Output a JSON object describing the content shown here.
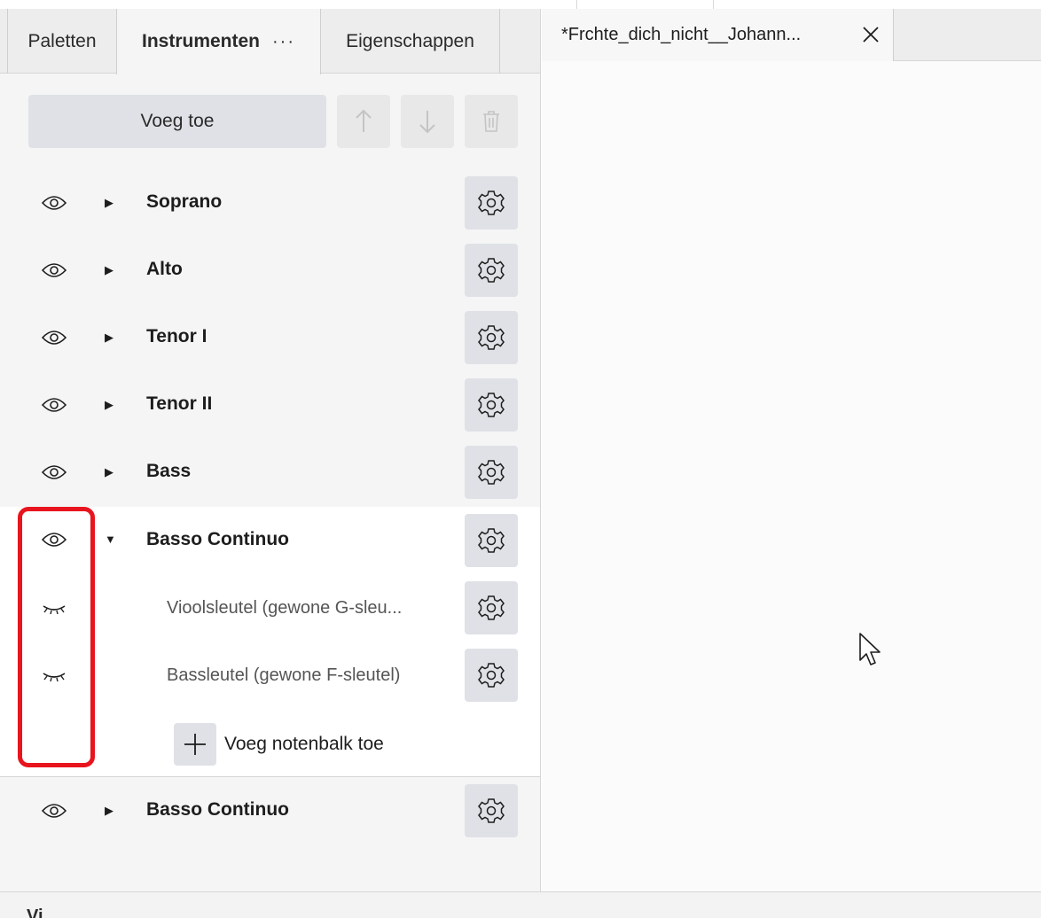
{
  "tabs": [
    {
      "label": "Paletten"
    },
    {
      "label": "Instrumenten",
      "more": "···"
    },
    {
      "label": "Eigenschappen"
    }
  ],
  "toolbar": {
    "add_label": "Voeg toe",
    "up_icon": "arrow-up-icon",
    "down_icon": "arrow-down-icon",
    "delete_icon": "trash-icon"
  },
  "instruments": [
    {
      "label": "Soprano",
      "visible": true,
      "expanded": false
    },
    {
      "label": "Alto",
      "visible": true,
      "expanded": false
    },
    {
      "label": "Tenor I",
      "visible": true,
      "expanded": false
    },
    {
      "label": "Tenor II",
      "visible": true,
      "expanded": false
    },
    {
      "label": "Bass",
      "visible": true,
      "expanded": false
    },
    {
      "label": "Basso Continuo",
      "visible": true,
      "expanded": true,
      "staves": [
        {
          "label": "Vioolsleutel (gewone G-sleu...",
          "visible": false
        },
        {
          "label": "Bassleutel (gewone F-sleutel)",
          "visible": false
        }
      ],
      "add_staff_label": "Voeg notenbalk toe"
    },
    {
      "label": "Basso Continuo",
      "visible": true,
      "expanded": false
    }
  ],
  "document": {
    "tab_title": "*Frchte_dich_nicht__Johann..."
  },
  "status": {
    "text": "Vi"
  },
  "colors": {
    "highlight": "#e8141e",
    "button_bg": "#dfe1e6"
  }
}
